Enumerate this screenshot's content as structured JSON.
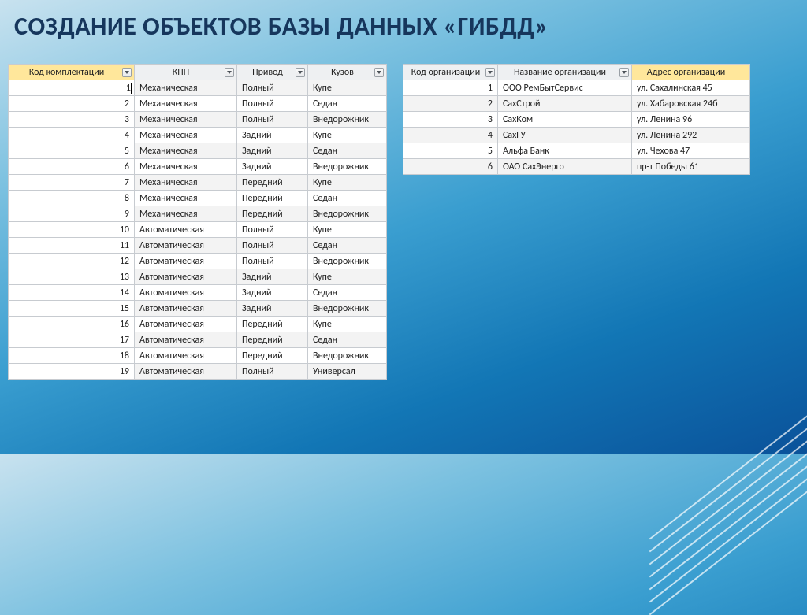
{
  "title": "СОЗДАНИЕ ОБЪЕКТОВ БАЗЫ ДАННЫХ «ГИБДД»",
  "table1": {
    "columns": [
      "Код комплектации",
      "КПП",
      "Привод",
      "Кузов"
    ],
    "edit_row": {
      "id": "1",
      "c2": "Механическая",
      "c3": "Полный",
      "c4": "Купе"
    },
    "rows": [
      {
        "id": "2",
        "c2": "Механическая",
        "c3": "Полный",
        "c4": "Седан"
      },
      {
        "id": "3",
        "c2": "Механическая",
        "c3": "Полный",
        "c4": "Внедорожник"
      },
      {
        "id": "4",
        "c2": "Механическая",
        "c3": "Задний",
        "c4": "Купе"
      },
      {
        "id": "5",
        "c2": "Механическая",
        "c3": "Задний",
        "c4": "Седан"
      },
      {
        "id": "6",
        "c2": "Механическая",
        "c3": "Задний",
        "c4": "Внедорожник"
      },
      {
        "id": "7",
        "c2": "Механическая",
        "c3": "Передний",
        "c4": "Купе"
      },
      {
        "id": "8",
        "c2": "Механическая",
        "c3": "Передний",
        "c4": "Седан"
      },
      {
        "id": "9",
        "c2": "Механическая",
        "c3": "Передний",
        "c4": "Внедорожник"
      },
      {
        "id": "10",
        "c2": "Автоматическая",
        "c3": "Полный",
        "c4": "Купе"
      },
      {
        "id": "11",
        "c2": "Автоматическая",
        "c3": "Полный",
        "c4": "Седан"
      },
      {
        "id": "12",
        "c2": "Автоматическая",
        "c3": "Полный",
        "c4": "Внедорожник"
      },
      {
        "id": "13",
        "c2": "Автоматическая",
        "c3": "Задний",
        "c4": "Купе"
      },
      {
        "id": "14",
        "c2": "Автоматическая",
        "c3": "Задний",
        "c4": "Седан"
      },
      {
        "id": "15",
        "c2": "Автоматическая",
        "c3": "Задний",
        "c4": "Внедорожник"
      },
      {
        "id": "16",
        "c2": "Автоматическая",
        "c3": "Передний",
        "c4": "Купе"
      },
      {
        "id": "17",
        "c2": "Автоматическая",
        "c3": "Передний",
        "c4": "Седан"
      },
      {
        "id": "18",
        "c2": "Автоматическая",
        "c3": "Передний",
        "c4": "Внедорожник"
      },
      {
        "id": "19",
        "c2": "Автоматическая",
        "c3": "Полный",
        "c4": "Универсал"
      }
    ]
  },
  "table2": {
    "columns": [
      "Код организации",
      "Название организации",
      "Адрес организации"
    ],
    "rows": [
      {
        "id": "1",
        "c2": "ООО РемБытСервис",
        "c3": "ул. Сахалинская 45"
      },
      {
        "id": "2",
        "c2": "СахСтрой",
        "c3": "ул. Хабаровская 24б"
      },
      {
        "id": "3",
        "c2": "СахКом",
        "c3": "ул. Ленина 96"
      },
      {
        "id": "4",
        "c2": "СахГУ",
        "c3": "ул. Ленина 292"
      },
      {
        "id": "5",
        "c2": "Альфа Банк",
        "c3": "ул. Чехова 47"
      },
      {
        "id": "6",
        "c2": "ОАО СахЭнерго",
        "c3": "пр-т Победы 61"
      }
    ]
  }
}
